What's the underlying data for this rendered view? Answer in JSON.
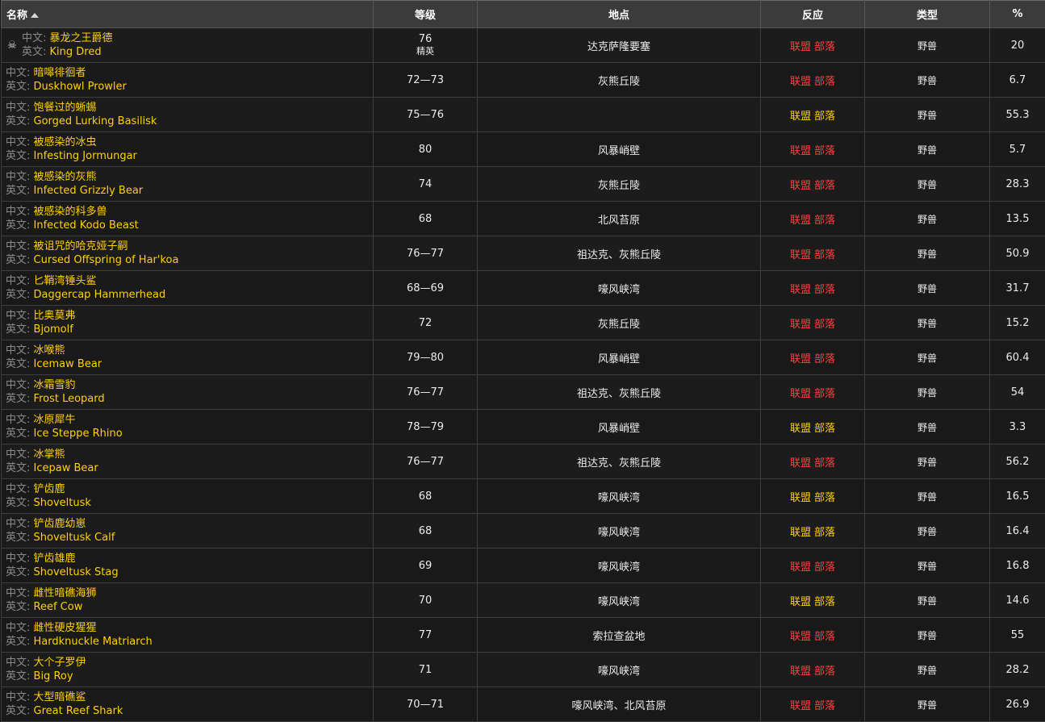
{
  "table": {
    "headers": {
      "name": "名称",
      "level": "等级",
      "location": "地点",
      "reaction": "反应",
      "type": "类型",
      "percent": "%"
    },
    "label_cn": "中文:",
    "label_en": "英文:",
    "colors": {
      "hostile": "#ff4040",
      "neutral": "#ffd100",
      "name_link": "#ffd100"
    },
    "rows": [
      {
        "cn": "暴龙之王爵德",
        "en": "King Dred",
        "level": "76",
        "level_sub": "精英",
        "location": "达克萨隆要塞",
        "ally": "联盟",
        "horde": "部落",
        "react": "hostile",
        "type": "野兽",
        "pct": "20",
        "icon": "skull-icon"
      },
      {
        "cn": "暗嗥徘徊者",
        "en": "Duskhowl Prowler",
        "level": "72—73",
        "location": "灰熊丘陵",
        "ally": "联盟",
        "horde": "部落",
        "react": "hostile",
        "type": "野兽",
        "pct": "6.7"
      },
      {
        "cn": "饱餐过的蜥蜴",
        "en": "Gorged Lurking Basilisk",
        "level": "75—76",
        "location": "",
        "ally": "联盟",
        "horde": "部落",
        "react": "neutral",
        "type": "野兽",
        "pct": "55.3"
      },
      {
        "cn": "被感染的冰虫",
        "en": "Infesting Jormungar",
        "level": "80",
        "location": "风暴峭壁",
        "ally": "联盟",
        "horde": "部落",
        "react": "hostile",
        "type": "野兽",
        "pct": "5.7"
      },
      {
        "cn": "被感染的灰熊",
        "en": "Infected Grizzly Bear",
        "level": "74",
        "location": "灰熊丘陵",
        "ally": "联盟",
        "horde": "部落",
        "react": "hostile",
        "type": "野兽",
        "pct": "28.3"
      },
      {
        "cn": "被感染的科多兽",
        "en": "Infected Kodo Beast",
        "level": "68",
        "location": "北风苔原",
        "ally": "联盟",
        "horde": "部落",
        "react": "hostile",
        "type": "野兽",
        "pct": "13.5"
      },
      {
        "cn": "被诅咒的哈克娅子嗣",
        "en": "Cursed Offspring of Har'koa",
        "level": "76—77",
        "location": "祖达克、灰熊丘陵",
        "ally": "联盟",
        "horde": "部落",
        "react": "hostile",
        "type": "野兽",
        "pct": "50.9"
      },
      {
        "cn": "匕鞘湾锤头鲨",
        "en": "Daggercap Hammerhead",
        "level": "68—69",
        "location": "嚎风峡湾",
        "ally": "联盟",
        "horde": "部落",
        "react": "hostile",
        "type": "野兽",
        "pct": "31.7"
      },
      {
        "cn": "比奥莫弗",
        "en": "Bjomolf",
        "level": "72",
        "location": "灰熊丘陵",
        "ally": "联盟",
        "horde": "部落",
        "react": "hostile",
        "type": "野兽",
        "pct": "15.2"
      },
      {
        "cn": "冰喉熊",
        "en": "Icemaw Bear",
        "level": "79—80",
        "location": "风暴峭壁",
        "ally": "联盟",
        "horde": "部落",
        "react": "hostile",
        "type": "野兽",
        "pct": "60.4"
      },
      {
        "cn": "冰霜雪豹",
        "en": "Frost Leopard",
        "level": "76—77",
        "location": "祖达克、灰熊丘陵",
        "ally": "联盟",
        "horde": "部落",
        "react": "hostile",
        "type": "野兽",
        "pct": "54"
      },
      {
        "cn": "冰原犀牛",
        "en": "Ice Steppe Rhino",
        "level": "78—79",
        "location": "风暴峭壁",
        "ally": "联盟",
        "horde": "部落",
        "react": "neutral",
        "type": "野兽",
        "pct": "3.3"
      },
      {
        "cn": "冰掌熊",
        "en": "Icepaw Bear",
        "level": "76—77",
        "location": "祖达克、灰熊丘陵",
        "ally": "联盟",
        "horde": "部落",
        "react": "hostile",
        "type": "野兽",
        "pct": "56.2"
      },
      {
        "cn": "铲齿鹿",
        "en": "Shoveltusk",
        "level": "68",
        "location": "嚎风峡湾",
        "ally": "联盟",
        "horde": "部落",
        "react": "neutral",
        "type": "野兽",
        "pct": "16.5"
      },
      {
        "cn": "铲齿鹿幼崽",
        "en": "Shoveltusk Calf",
        "level": "68",
        "location": "嚎风峡湾",
        "ally": "联盟",
        "horde": "部落",
        "react": "neutral",
        "type": "野兽",
        "pct": "16.4"
      },
      {
        "cn": "铲齿雄鹿",
        "en": "Shoveltusk Stag",
        "level": "69",
        "location": "嚎风峡湾",
        "ally": "联盟",
        "horde": "部落",
        "react": "hostile",
        "type": "野兽",
        "pct": "16.8"
      },
      {
        "cn": "雌性暗礁海狮",
        "en": "Reef Cow",
        "level": "70",
        "location": "嚎风峡湾",
        "ally": "联盟",
        "horde": "部落",
        "react": "neutral",
        "type": "野兽",
        "pct": "14.6"
      },
      {
        "cn": "雌性硬皮猩猩",
        "en": "Hardknuckle Matriarch",
        "level": "77",
        "location": "索拉查盆地",
        "ally": "联盟",
        "horde": "部落",
        "react": "hostile",
        "type": "野兽",
        "pct": "55"
      },
      {
        "cn": "大个子罗伊",
        "en": "Big Roy",
        "level": "71",
        "location": "嚎风峡湾",
        "ally": "联盟",
        "horde": "部落",
        "react": "hostile",
        "type": "野兽",
        "pct": "28.2"
      },
      {
        "cn": "大型暗礁鲨",
        "en": "Great Reef Shark",
        "level": "70—71",
        "location": "嚎风峡湾、北风苔原",
        "ally": "联盟",
        "horde": "部落",
        "react": "hostile",
        "type": "野兽",
        "pct": "26.9"
      }
    ]
  }
}
